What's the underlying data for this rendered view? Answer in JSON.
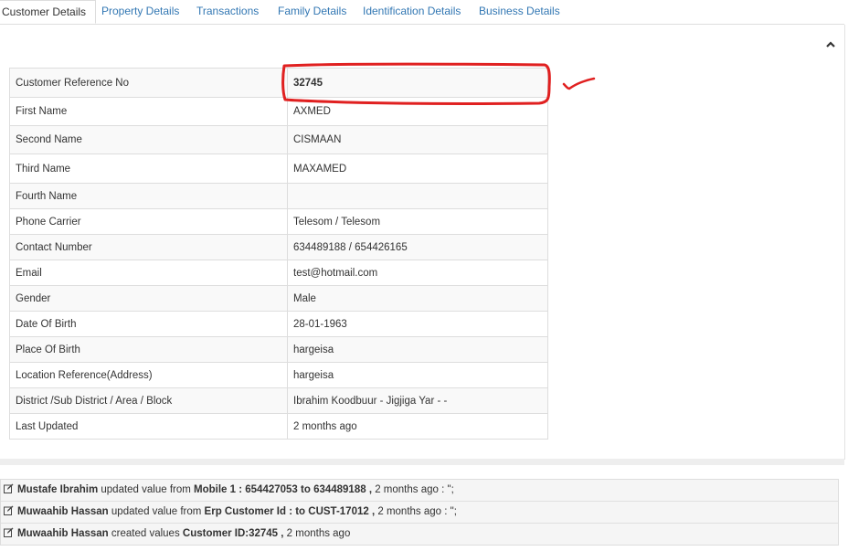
{
  "tabs": [
    {
      "label": "Customer Details",
      "active": true
    },
    {
      "label": "Property Details",
      "active": false
    },
    {
      "label": "Transactions",
      "active": false
    },
    {
      "label": "Family Details",
      "active": false
    },
    {
      "label": "Identification Details",
      "active": false
    },
    {
      "label": "Business Details",
      "active": false
    }
  ],
  "collapse_icon": "chevron-up-icon",
  "details": [
    {
      "label": "Customer Reference No",
      "value": "32745"
    },
    {
      "label": "First Name",
      "value": "AXMED"
    },
    {
      "label": "Second Name",
      "value": "CISMAAN"
    },
    {
      "label": "Third Name",
      "value": "MAXAMED"
    },
    {
      "label": "Fourth Name",
      "value": ""
    },
    {
      "label": "Phone Carrier",
      "value": "Telesom / Telesom"
    },
    {
      "label": "Contact Number",
      "value": "634489188 / 654426165"
    },
    {
      "label": "Email",
      "value": "test@hotmail.com"
    },
    {
      "label": "Gender",
      "value": "Male"
    },
    {
      "label": "Date Of Birth",
      "value": "28-01-1963"
    },
    {
      "label": "Place Of Birth",
      "value": "hargeisa"
    },
    {
      "label": "Location Reference(Address)",
      "value": "hargeisa"
    },
    {
      "label": "District /Sub District / Area / Block",
      "value": "Ibrahim Koodbuur - Jigjiga Yar - -"
    },
    {
      "label": "Last Updated",
      "value": "2 months ago"
    }
  ],
  "annotation_color": "#e02020",
  "activity": [
    {
      "user": "Mustafe Ibrahim",
      "action": " updated value from ",
      "detail": "Mobile 1 : 654427053 to 634489188 ,",
      "time": " 2 months ago : \";"
    },
    {
      "user": "Muwaahib Hassan",
      "action": " updated value from ",
      "detail": "Erp Customer Id : to CUST-17012 ,",
      "time": " 2 months ago : \";"
    },
    {
      "user": "Muwaahib Hassan",
      "action": " created values ",
      "detail": "Customer ID:32745 ,",
      "time": " 2 months ago"
    }
  ]
}
